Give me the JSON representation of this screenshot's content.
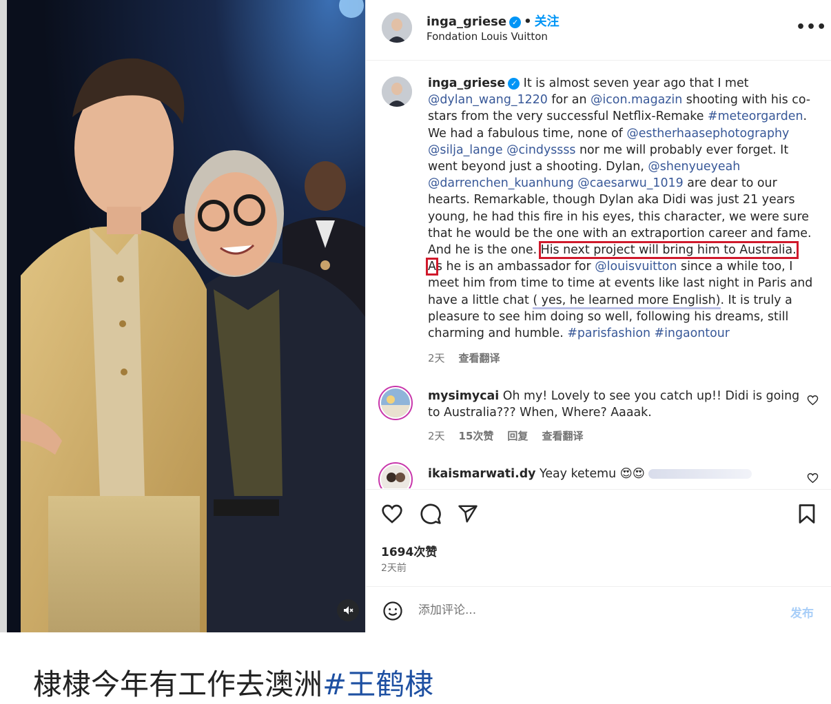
{
  "post_header": {
    "username": "inga_griese",
    "separator": "•",
    "follow_label": "关注",
    "location": "Fondation Louis Vuitton",
    "more_label": "•••"
  },
  "caption": {
    "username": "inga_griese",
    "t1": " It is almost seven year ago that I met ",
    "m1": "@dylan_wang_1220",
    "t2": " for an ",
    "m2": "@icon.magazin",
    "t3": " shooting with his co-stars from the very successful Netflix-Remake ",
    "m3": "#meteorgarden",
    "t4": ". We had a fabulous time, none of ",
    "m4": "@estherhaasephotography",
    "t5": " ",
    "m5": "@silja_lange",
    "t6": " ",
    "m6": "@cindyssss",
    "t7": " nor me will probably ever forget. It went beyond just a shooting. Dylan, ",
    "m7": "@shenyueyeah",
    "t8": " ",
    "m8": "@darrenchen_kuanhung",
    "t9": " ",
    "m9": "@caesarwu_1019",
    "t10": " are dear to our hearts. Remarkable, though Dylan aka Didi was just 21 years young, he had this fire in his eyes, this character, we were sure that he would be the one with an extraportion career and fame. And he is the one. ",
    "highlight": "His next project will bring him to Australia. A",
    "t11": "s he is an ambassador for ",
    "m10": "@louisvuitton",
    "t12": " since a while too, I meet him from time to time at events like last night in Paris and have a little chat ",
    "underlined": "( yes, he learned more English)",
    "t13": ". It is truly a pleasure to see him doing so well, following his dreams, still charming and humble. ",
    "m11": "#parisfashion",
    "t14": " ",
    "m12": "#ingaontour",
    "time": "2天",
    "translate": "查看翻译"
  },
  "comments": [
    {
      "username": "mysimycai",
      "text": " Oh my! Lovely to see you catch up!! Didi is going to Australia??? When, Where? Aaaak.",
      "time": "2天",
      "likes": "15次赞",
      "reply": "回复",
      "translate": "查看翻译"
    },
    {
      "username": "ikaismarwati.dy",
      "text": " Yeay ketemu 😍😍 "
    }
  ],
  "actions": {
    "likes": "1694次赞",
    "date": "2天前"
  },
  "add_comment": {
    "placeholder": "添加评论...",
    "post_label": "发布"
  },
  "bottom_caption": {
    "text": "棣棣今年有工作去澳洲",
    "hashtag": "#王鹤棣"
  },
  "colors": {
    "link": "#385898",
    "follow": "#0095f6",
    "highlight_box": "#d0192b",
    "hashtag_bottom": "#1e50a2"
  },
  "icons": [
    "heart-icon",
    "comment-icon",
    "share-icon",
    "bookmark-icon",
    "emoji-icon",
    "mute-icon",
    "more-icon",
    "verified-icon"
  ]
}
